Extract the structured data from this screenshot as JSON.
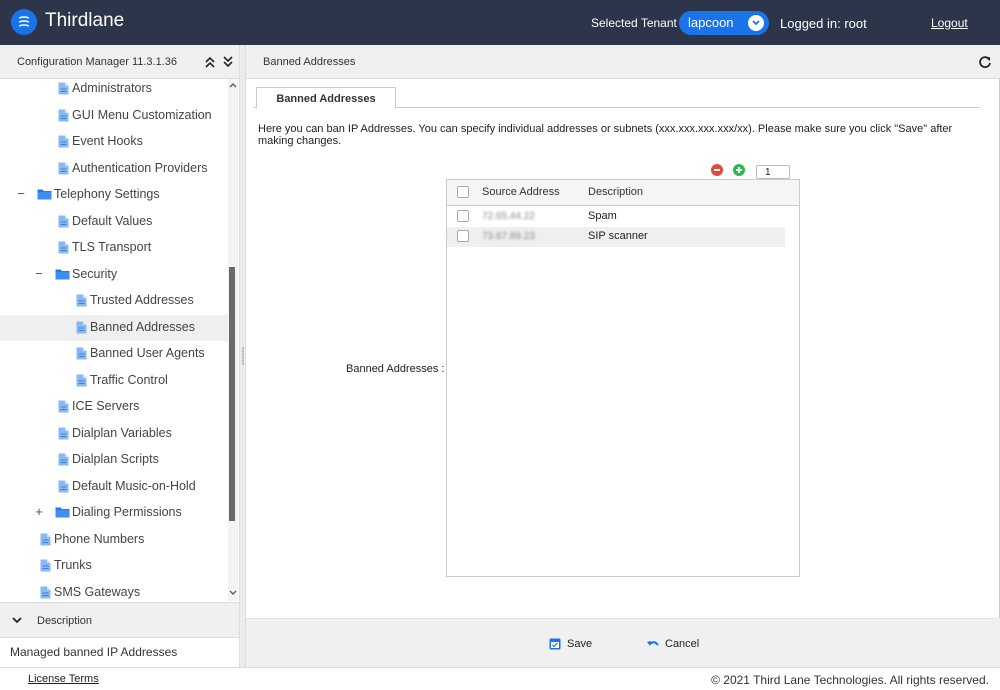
{
  "app": {
    "brand": "Thirdlane",
    "tenant_label": "Selected Tenant :",
    "tenant_value": "lapcoon",
    "logged_in": "Logged in: root",
    "logout": "Logout"
  },
  "sidebar": {
    "title": "Configuration Manager 11.3.1.36",
    "items": [
      {
        "label": "Administrators",
        "type": "page",
        "level": 2
      },
      {
        "label": "GUI Menu Customization",
        "type": "page",
        "level": 2
      },
      {
        "label": "Event Hooks",
        "type": "page",
        "level": 2
      },
      {
        "label": "Authentication Providers",
        "type": "page",
        "level": 2
      },
      {
        "label": "Telephony Settings",
        "type": "folder",
        "level": 1,
        "toggle": "−"
      },
      {
        "label": "Default Values",
        "type": "page",
        "level": 2
      },
      {
        "label": "TLS Transport",
        "type": "page",
        "level": 2
      },
      {
        "label": "Security",
        "type": "folder",
        "level": 2,
        "toggle": "−"
      },
      {
        "label": "Trusted Addresses",
        "type": "page",
        "level": 3
      },
      {
        "label": "Banned Addresses",
        "type": "page",
        "level": 3,
        "selected": true
      },
      {
        "label": "Banned User Agents",
        "type": "page",
        "level": 3
      },
      {
        "label": "Traffic Control",
        "type": "page",
        "level": 3
      },
      {
        "label": "ICE Servers",
        "type": "page",
        "level": 2
      },
      {
        "label": "Dialplan Variables",
        "type": "page",
        "level": 2
      },
      {
        "label": "Dialplan Scripts",
        "type": "page",
        "level": 2
      },
      {
        "label": "Default Music-on-Hold",
        "type": "page",
        "level": 2
      },
      {
        "label": "Dialing Permissions",
        "type": "folder",
        "level": 2,
        "toggle": "+"
      },
      {
        "label": "Phone Numbers",
        "type": "page",
        "level": 1
      },
      {
        "label": "Trunks",
        "type": "page",
        "level": 1
      },
      {
        "label": "SMS Gateways",
        "type": "page",
        "level": 1
      }
    ],
    "description_title": "Description",
    "description_text": "Managed banned IP Addresses"
  },
  "main": {
    "header_title": "Banned Addresses",
    "tab_label": "Banned Addresses",
    "intro": "Here you can ban IP Addresses. You can specify individual addresses or subnets (xxx.xxx.xxx.xxx/xx). Please make sure you click \"Save\" after making changes.",
    "field_label": "Banned Addresses :",
    "page_number": "1",
    "columns": [
      "Source Address",
      "Description"
    ],
    "rows": [
      {
        "address": "72.65.44.22",
        "description": "Spam"
      },
      {
        "address": "73.67.89.23",
        "description": "SIP scanner"
      }
    ],
    "save_label": "Save",
    "cancel_label": "Cancel"
  },
  "footer": {
    "license": "License Terms",
    "copyright": "© 2021 Third Lane Technologies. All rights reserved."
  },
  "colors": {
    "topbar": "#2c3549",
    "accent": "#1a73e8",
    "remove": "#e24a3f",
    "add": "#2db84b"
  }
}
